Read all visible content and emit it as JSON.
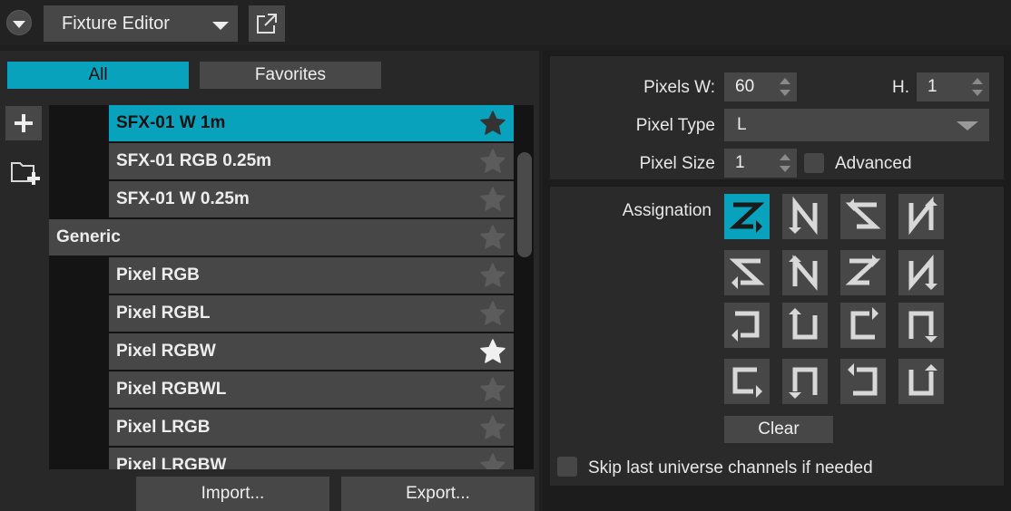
{
  "header": {
    "module_select": "Fixture Editor",
    "collapse_icon": "chevron-down-icon",
    "detach_icon": "external-link-icon"
  },
  "filters": {
    "all": "All",
    "favorites": "Favorites"
  },
  "fixture_list": {
    "rows": [
      {
        "label": "SFX-01 W 1m",
        "selected": true,
        "favorite": true,
        "indent": true
      },
      {
        "label": "SFX-01 RGB 0.25m",
        "selected": false,
        "favorite": false,
        "indent": true
      },
      {
        "label": "SFX-01 W 0.25m",
        "selected": false,
        "favorite": false,
        "indent": true
      },
      {
        "label": "Generic",
        "selected": false,
        "favorite": false,
        "indent": false
      },
      {
        "label": "Pixel RGB",
        "selected": false,
        "favorite": false,
        "indent": true
      },
      {
        "label": "Pixel RGBL",
        "selected": false,
        "favorite": false,
        "indent": true
      },
      {
        "label": "Pixel RGBW",
        "selected": false,
        "favorite": true,
        "indent": true
      },
      {
        "label": "Pixel RGBWL",
        "selected": false,
        "favorite": false,
        "indent": true
      },
      {
        "label": "Pixel LRGB",
        "selected": false,
        "favorite": false,
        "indent": true
      },
      {
        "label": "Pixel LRGBW",
        "selected": false,
        "favorite": false,
        "indent": true
      }
    ]
  },
  "actions": {
    "import": "Import...",
    "export": "Export..."
  },
  "properties": {
    "pixels_w_label": "Pixels W:",
    "pixels_w_value": "60",
    "h_label": "H.",
    "h_value": "1",
    "pixel_type_label": "Pixel Type",
    "pixel_type_value": "L",
    "pixel_size_label": "Pixel Size",
    "pixel_size_value": "1",
    "advanced_label": "Advanced",
    "advanced_checked": false
  },
  "assignation": {
    "label": "Assignation",
    "clear": "Clear",
    "skip_label": "Skip last universe channels if needed",
    "skip_checked": false,
    "patterns": [
      "zigzag-z-right-start-icon",
      "zigzag-n-up-icon",
      "zigzag-z-left-icon",
      "zigzag-n-down-icon",
      "zigzag-s-left-icon",
      "zigzag-n-reverse-up-icon",
      "zigzag-s-right-icon",
      "zigzag-n-reverse-down-icon",
      "snake-left-icon",
      "snake-up-icon",
      "snake-right-icon",
      "snake-down-icon",
      "snake-right-alt-icon",
      "snake-down-alt-icon",
      "snake-left-alt-icon",
      "snake-up-alt-icon"
    ],
    "active_index": 0
  },
  "colors": {
    "accent": "#09a2bd",
    "button": "#474747",
    "panel": "#2a2a2a"
  }
}
